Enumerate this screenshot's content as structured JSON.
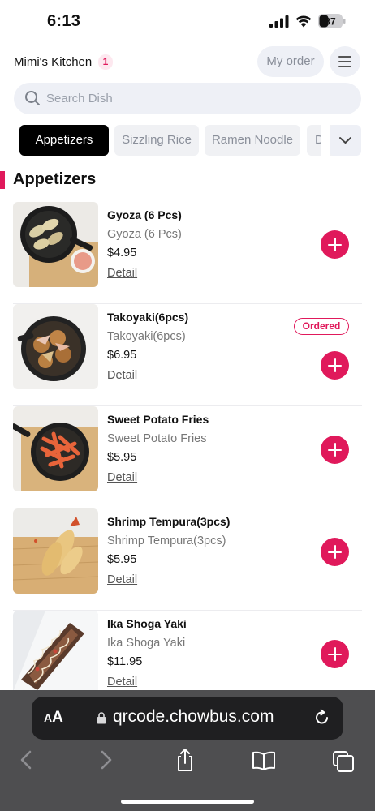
{
  "status_bar": {
    "time": "6:13",
    "battery": "37"
  },
  "header": {
    "restaurant_name": "Mimi's Kitchen",
    "cart_count": "1",
    "my_order_label": "My order"
  },
  "search": {
    "placeholder": "Search Dish",
    "value": ""
  },
  "tabs": [
    {
      "label": "Appetizers",
      "active": true
    },
    {
      "label": "Sizzling Rice",
      "active": false
    },
    {
      "label": "Ramen Noodle",
      "active": false
    },
    {
      "label": "D",
      "active": false
    }
  ],
  "section": {
    "title": "Appetizers"
  },
  "items": [
    {
      "title": "Gyoza (6 Pcs)",
      "subtitle": "Gyoza (6 Pcs)",
      "price": "$4.95",
      "detail": "Detail",
      "ordered": false
    },
    {
      "title": "Takoyaki(6pcs)",
      "subtitle": "Takoyaki(6pcs)",
      "price": "$6.95",
      "detail": "Detail",
      "ordered": true,
      "ordered_label": "Ordered"
    },
    {
      "title": "Sweet Potato Fries",
      "subtitle": "Sweet Potato Fries",
      "price": "$5.95",
      "detail": "Detail",
      "ordered": false
    },
    {
      "title": "Shrimp Tempura(3pcs)",
      "subtitle": "Shrimp Tempura(3pcs)",
      "price": "$5.95",
      "detail": "Detail",
      "ordered": false
    },
    {
      "title": "Ika Shoga Yaki",
      "subtitle": "Ika Shoga Yaki",
      "price": "$11.95",
      "detail": "Detail",
      "ordered": false
    }
  ],
  "browser": {
    "text_size_small": "A",
    "text_size_big": "A",
    "url": "qrcode.chowbus.com"
  },
  "colors": {
    "accent": "#e0195b",
    "active_tab": "#000000",
    "browser_bar": "#4e4e50"
  }
}
